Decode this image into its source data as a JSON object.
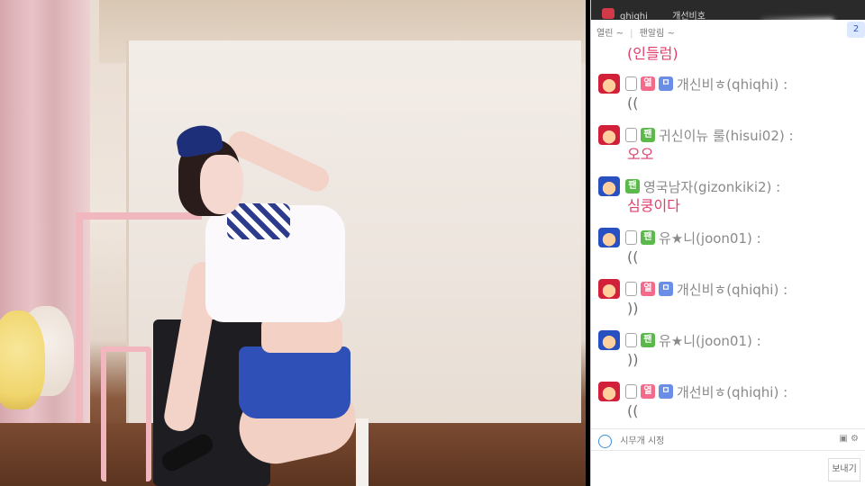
{
  "chat": {
    "header_rows": [
      {
        "name": "",
        "nick": ""
      },
      {
        "name": "qhiqhi",
        "nick": "개선비호"
      }
    ],
    "top_right_badge": "2",
    "toolbar": {
      "items": [
        "열린 ~",
        "팬알림 ~"
      ]
    },
    "messages": [
      {
        "avatar": "red",
        "badges": [],
        "nick": "",
        "text": "(인들럼)"
      },
      {
        "avatar": "red",
        "badges": [
          "phone",
          "fan",
          "sub"
        ],
        "nick": "개신비ㅎ(qhiqhi) :",
        "text": "(("
      },
      {
        "avatar": "red",
        "badges": [
          "phone",
          "green"
        ],
        "nick": "귀신이뉴 룰(hisui02) :",
        "text": "오오"
      },
      {
        "avatar": "blue",
        "badges": [
          "green"
        ],
        "nick": "영국남자(gizonkiki2) :",
        "text": "심쿵이다"
      },
      {
        "avatar": "blue",
        "badges": [
          "phone",
          "green"
        ],
        "nick": "유★니(joon01) :",
        "text": "(("
      },
      {
        "avatar": "red",
        "badges": [
          "phone",
          "fan",
          "sub"
        ],
        "nick": "개신비ㅎ(qhiqhi) :",
        "text": "))"
      },
      {
        "avatar": "blue",
        "badges": [
          "phone",
          "green"
        ],
        "nick": "유★니(joon01) :",
        "text": "))"
      },
      {
        "avatar": "red",
        "badges": [
          "phone",
          "fan",
          "sub"
        ],
        "nick": "개선비ㅎ(qhiqhi) :",
        "text": "(("
      }
    ],
    "bottom_bar": {
      "left_label": "시무개 시정",
      "right_icons": "▣ ⚙"
    },
    "send_label": "보내기"
  },
  "badge_labels": {
    "phone": "",
    "fan": "열",
    "sub": "ㅁ",
    "green": "팬"
  }
}
